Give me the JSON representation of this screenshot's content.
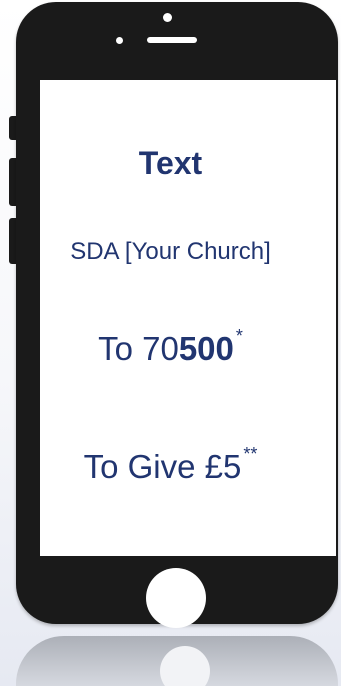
{
  "screen_text": {
    "title": "Text",
    "church": "SDA [Your Church]",
    "number_prefix": "To 70",
    "number_bold": "500",
    "number_mark": "*",
    "give_text": "To Give £5",
    "give_mark": "**"
  },
  "colors": {
    "text": "#213570",
    "phone_body": "#1a1a1a"
  },
  "icons": {
    "phone": "smartphone-icon",
    "home": "home-button-icon"
  }
}
